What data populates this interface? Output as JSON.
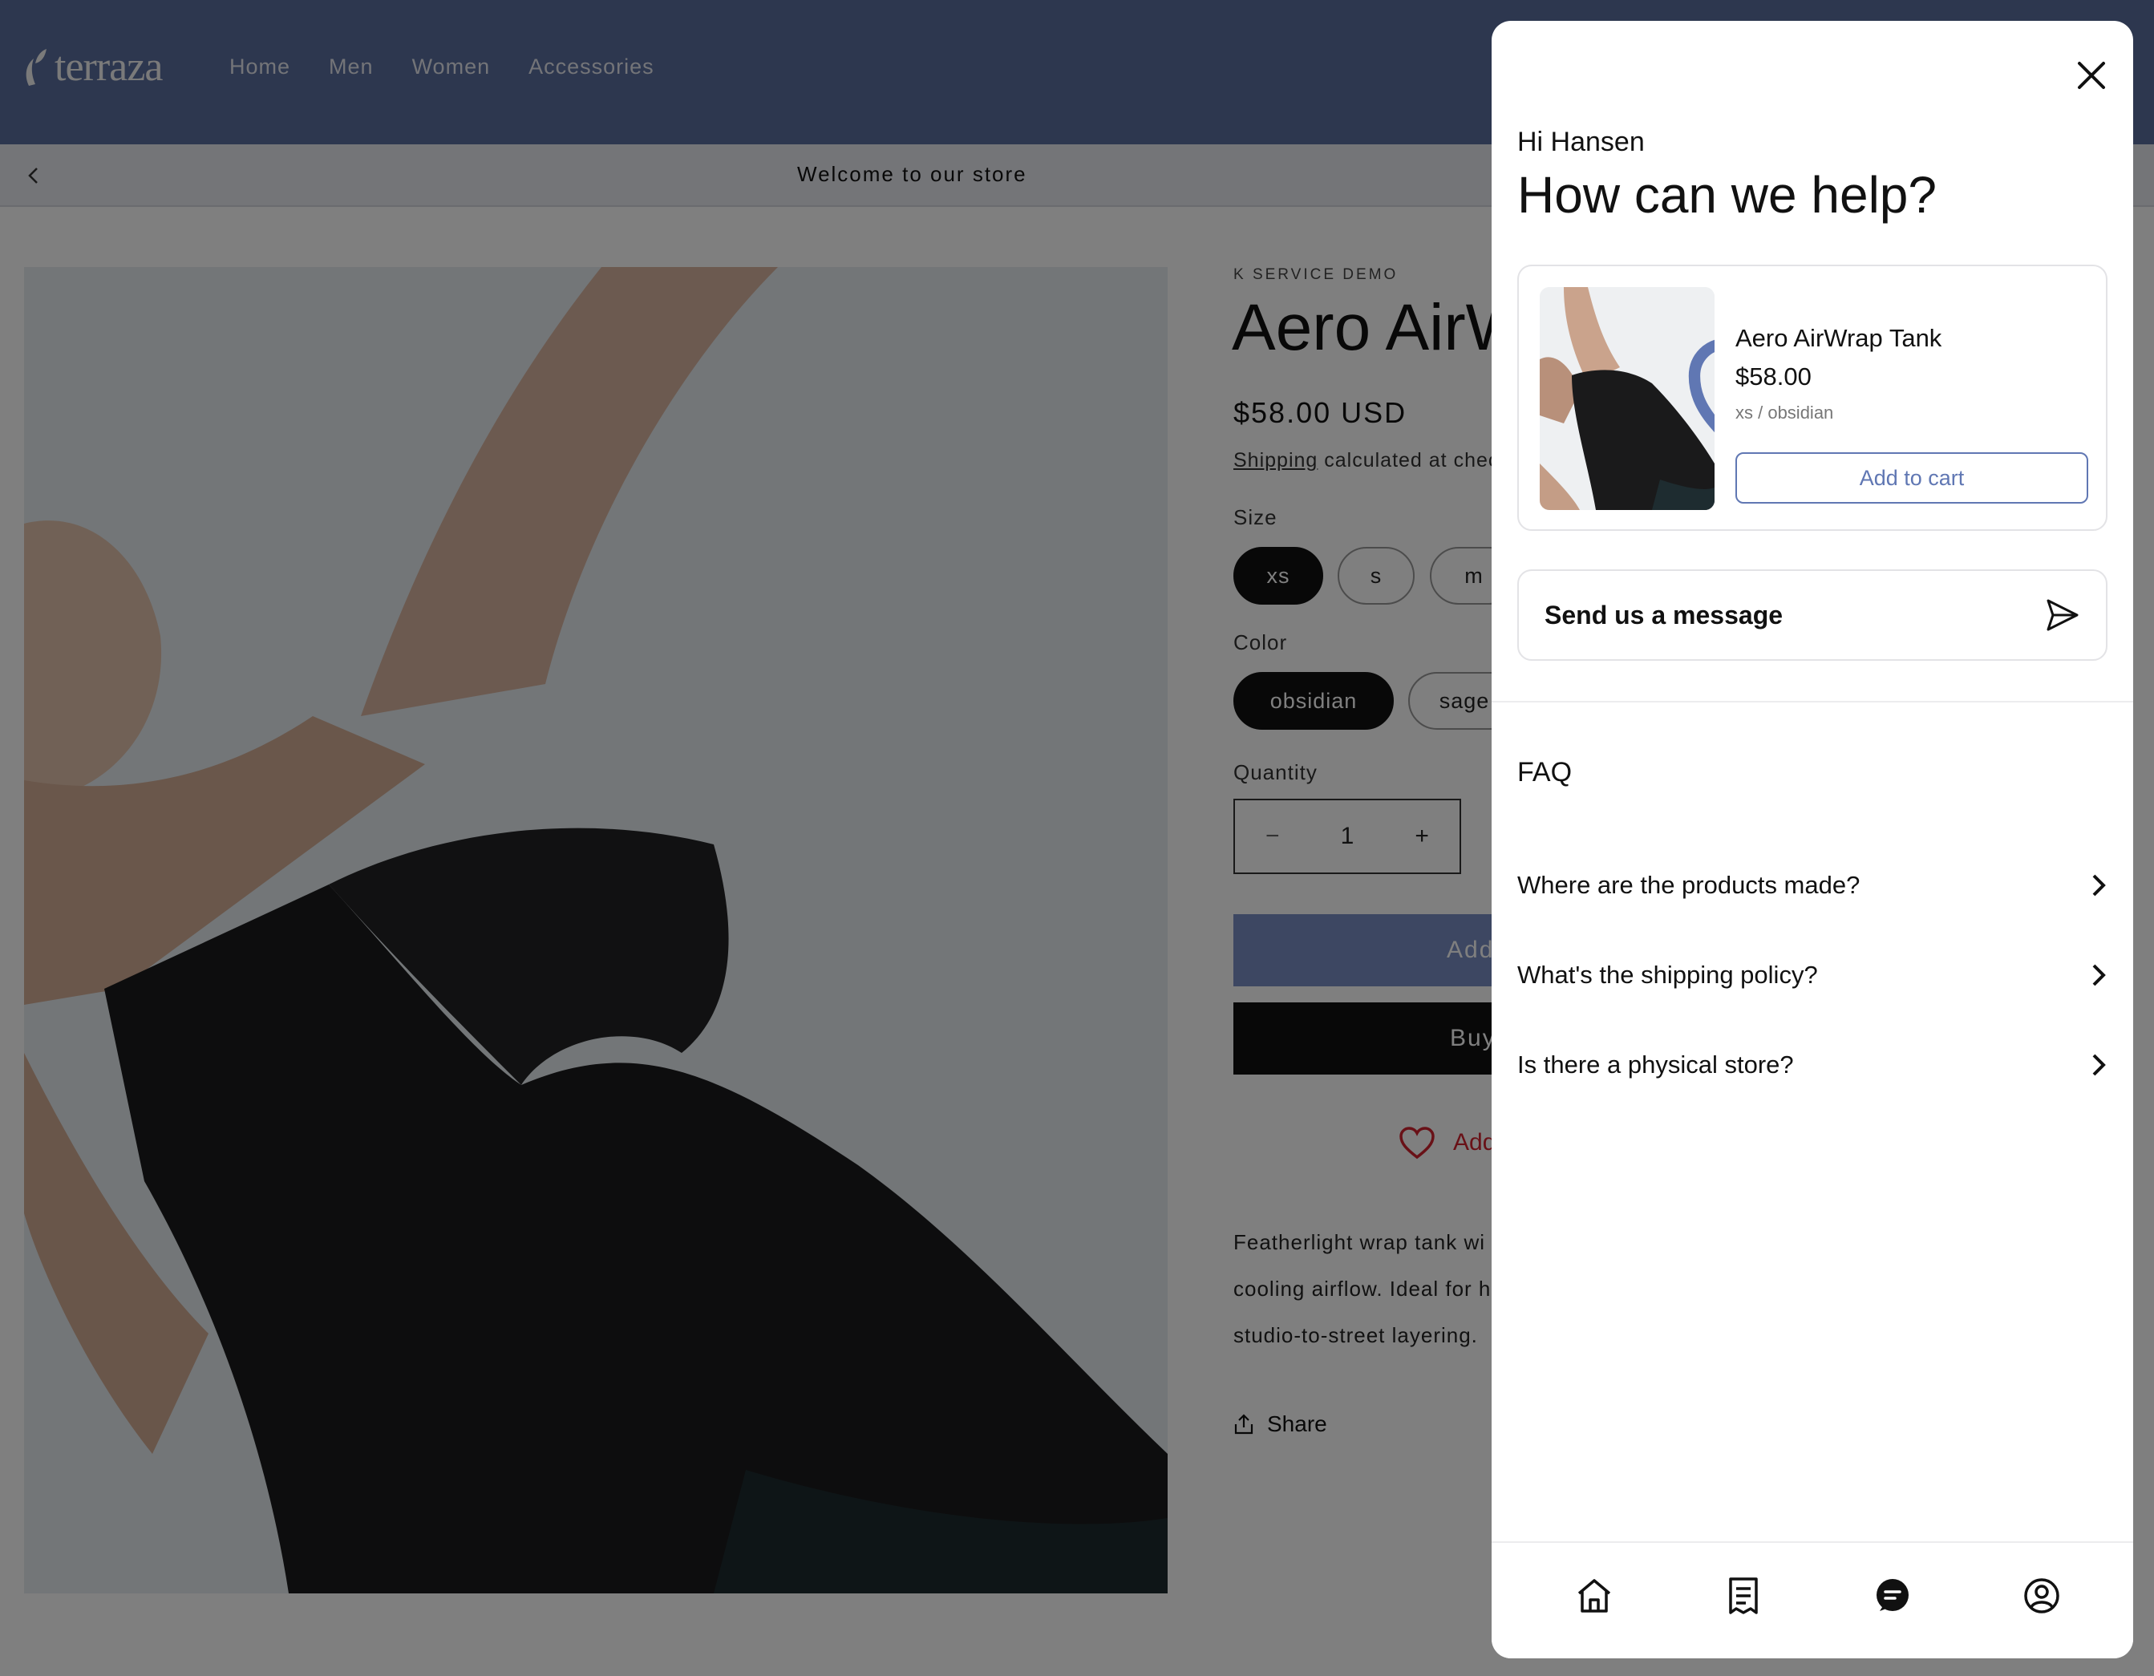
{
  "store": {
    "logo_text": "terraza",
    "nav": [
      "Home",
      "Men",
      "Women",
      "Accessories"
    ],
    "announcement": "Welcome to our store"
  },
  "product": {
    "vendor": "K SERVICE DEMO",
    "title": "Aero AirW",
    "price": "$58.00 USD",
    "shipping_link": "Shipping",
    "shipping_rest": " calculated at check",
    "size_label": "Size",
    "sizes": [
      "xs",
      "s",
      "m"
    ],
    "selected_size": "xs",
    "color_label": "Color",
    "colors": [
      "obsidian",
      "sage"
    ],
    "selected_color": "obsidian",
    "quantity_label": "Quantity",
    "quantity": "1",
    "qty_minus": "−",
    "qty_plus": "+",
    "add_to_cart": "Add",
    "buy_now": "Buy",
    "wishlist": "Add",
    "description_lines": [
      "Featherlight wrap tank wi",
      "cooling airflow. Ideal for h",
      "studio-to-street layering."
    ],
    "share": "Share"
  },
  "widget": {
    "greeting": "Hi Hansen",
    "title": "How can we help?",
    "card": {
      "name": "Aero AirWrap Tank",
      "price": "$58.00",
      "variant": "xs / obsidian",
      "add_to_cart": "Add to cart"
    },
    "send_message": "Send us a message",
    "faq_title": "FAQ",
    "faq": [
      "Where are the products made?",
      "What's the shipping policy?",
      "Is there a physical store?"
    ],
    "tabs": [
      "home-icon",
      "orders-icon",
      "chat-icon",
      "account-icon"
    ],
    "accent_color": "#6077b3"
  },
  "colors": {
    "header_bg": "#5b6e9e",
    "add_button": "#7b8fc4",
    "wishlist": "#d2232f"
  }
}
